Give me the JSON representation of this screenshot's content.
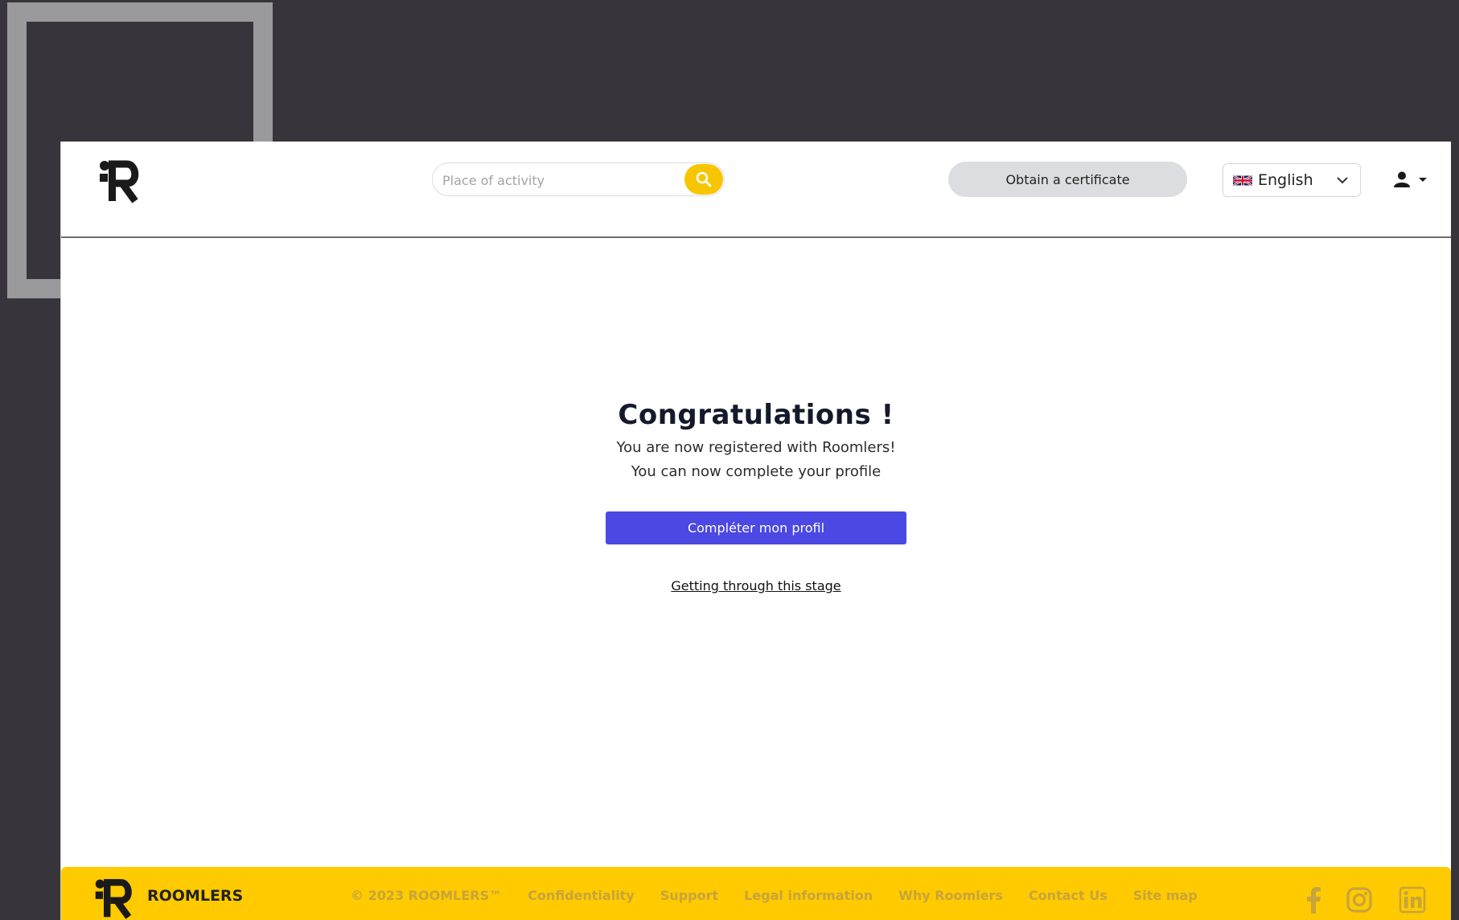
{
  "header": {
    "search_placeholder": "Place of activity",
    "certificate_label": "Obtain a certificate",
    "language_label": "English"
  },
  "main": {
    "title": "Congratulations !",
    "line1": "You are now registered with Roomlers!",
    "line2": "You can now complete your profile",
    "cta_label": "Compléter mon profil",
    "skip_label": "Getting through this stage"
  },
  "footer": {
    "brand": "ROOMLERS",
    "copyright": "© 2023 ROOMLERS™",
    "links": [
      "Confidentiality",
      "Support",
      "Legal information",
      "Why Roomlers",
      "Contact Us",
      "Site map"
    ]
  },
  "icons": {
    "search": "search-icon",
    "language_flag": "uk-flag-icon",
    "chevron": "chevron-down-icon",
    "user": "user-icon",
    "facebook": "facebook-icon",
    "instagram": "instagram-icon",
    "linkedin": "linkedin-icon"
  },
  "colors": {
    "accent_yellow": "#ffca00",
    "primary_button": "#4b48e3",
    "background": "#37353b"
  }
}
